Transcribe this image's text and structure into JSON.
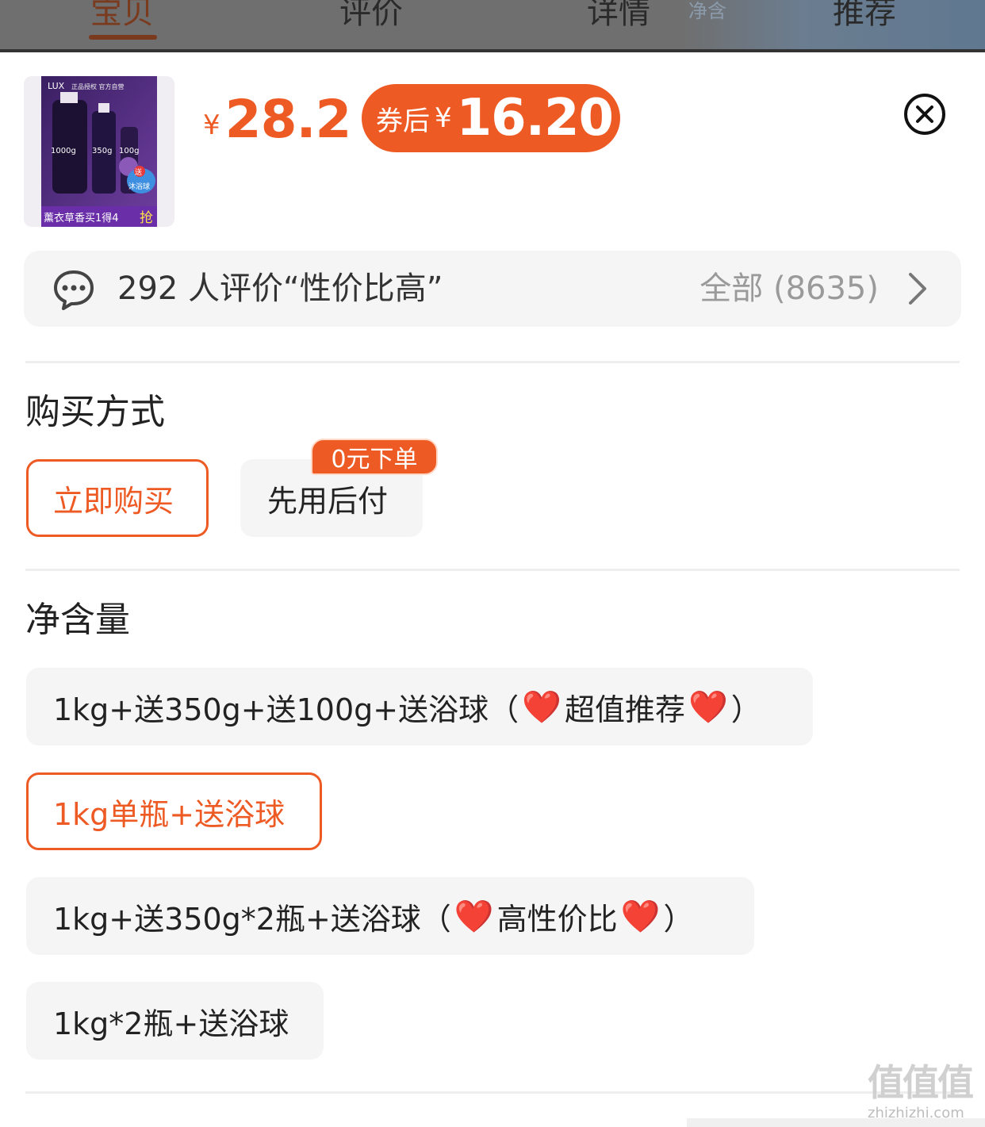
{
  "tabs": [
    {
      "label": "宝贝",
      "active": true
    },
    {
      "label": "评价",
      "active": false
    },
    {
      "label": "详情",
      "active": false
    },
    {
      "label": "推荐",
      "active": false
    }
  ],
  "product": {
    "currency": "¥",
    "price": "28.2",
    "coupon_label": "券后",
    "coupon_currency": "¥",
    "coupon_price": "16.20",
    "thumb_lines": {
      "brand": "LUX",
      "top_text": "正品授权 官方自营",
      "size1": "1000g",
      "size2": "350g",
      "size3": "100g",
      "gift_tag": "送",
      "gift_item": "沐浴球",
      "bottom_text": "薰衣草香买1得4",
      "bottom_action": "抢"
    }
  },
  "review": {
    "summary": "292 人评价“性价比高”",
    "all_label": "全部 (8635)"
  },
  "purchase": {
    "title": "购买方式",
    "options": [
      "立即购买",
      "先用后付"
    ],
    "badge": "0元下单",
    "selected_index": 0
  },
  "net_content": {
    "title": "净含量",
    "options": [
      {
        "pre": "1kg+送350g+送100g+送浴球（",
        "mid": "超值推荐",
        "post": "）"
      },
      {
        "pre": "1kg单瓶+送浴球",
        "mid": "",
        "post": ""
      },
      {
        "pre": "1kg+送350g*2瓶+送浴球（",
        "mid": "高性价比",
        "post": "）"
      },
      {
        "pre": "1kg*2瓶+送浴球",
        "mid": "",
        "post": ""
      }
    ],
    "selected_index": 1
  },
  "watermark": {
    "big": "值值值",
    "small": "zhizhizhi.com"
  },
  "icons": {
    "close": "close-circle-icon",
    "chat": "chat-bubble-icon",
    "chevron": "chevron-right-icon",
    "heart": "❤️"
  },
  "colors": {
    "accent": "#ee5a24",
    "text": "#222222",
    "muted": "#9a9a9a",
    "chip_bg": "#f5f5f5"
  }
}
